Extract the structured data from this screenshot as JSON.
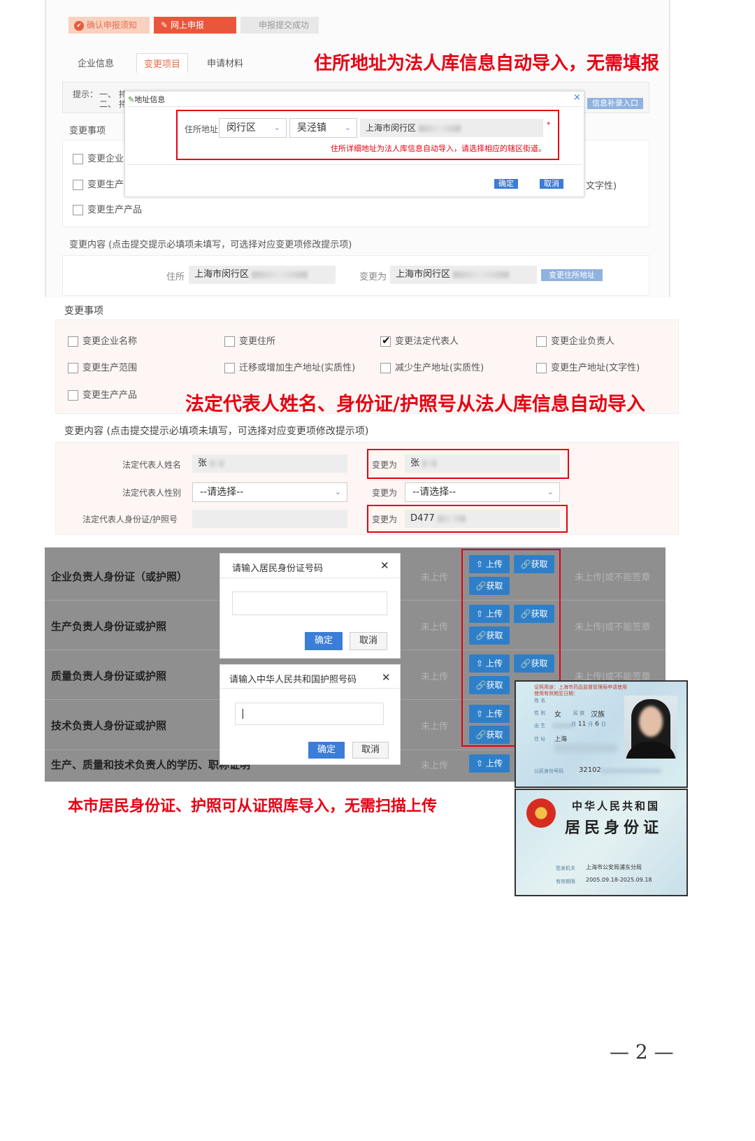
{
  "steps": [
    "确认申报须知",
    "网上申报",
    "申报提交成功"
  ],
  "tabs": [
    "企业信息",
    "变更项目",
    "申请材料"
  ],
  "top_note": "住所地址为法人库信息自动导入，无需填报",
  "hint_label": "提示：",
  "hint_lines": [
    "一、 持",
    "二、 持"
  ],
  "supplement_link": "信息补录入口",
  "address_dialog": {
    "title": "地址信息",
    "close": "×",
    "field_label": "住所地址",
    "district": "闵行区",
    "town": "吴泾镇",
    "detail_prefix": "上海市闵行区",
    "required_mark": "*",
    "tip": "住所详细地址为法人库信息自动导入，请选择相应的辖区街道。",
    "confirm": "确定",
    "cancel": "取消"
  },
  "upper_section": {
    "items_title": "变更事项",
    "items": [
      "变更企业",
      "变更生产",
      "变更生产产品"
    ],
    "right_fragment": "文字性)",
    "content_title": "变更内容 (点击提交提示必填项未填写，可选择对应变更项修改提示项)",
    "address_label": "住所",
    "address_value": "上海市闵行区",
    "change_to": "变更为",
    "change_value": "上海市闵行区",
    "change_btn": "变更住所地址"
  },
  "items_section": {
    "title": "变更事项",
    "rows": [
      [
        {
          "label": "变更企业名称",
          "checked": false
        },
        {
          "label": "变更住所",
          "checked": false
        },
        {
          "label": "变更法定代表人",
          "checked": true
        },
        {
          "label": "变更企业负责人",
          "checked": false
        }
      ],
      [
        {
          "label": "变更生产范围",
          "checked": false
        },
        {
          "label": "迁移或增加生产地址(实质性)",
          "checked": false
        },
        {
          "label": "减少生产地址(实质性)",
          "checked": false
        },
        {
          "label": "变更生产地址(文字性)",
          "checked": false
        }
      ],
      [
        {
          "label": "变更生产产品",
          "checked": false
        }
      ]
    ]
  },
  "legal_note": "法定代表人姓名、身份证/护照号从法人库信息自动导入",
  "content_section": {
    "title": "变更内容 (点击提交提示必填项未填写，可选择对应变更项修改提示项)",
    "name_label": "法定代表人姓名",
    "name_value": "张",
    "gender_label": "法定代表人性别",
    "gender_value": "--请选择--",
    "id_label": "法定代表人身份证/护照号",
    "change_to": "变更为",
    "name_new": "张",
    "gender_new": "--请选择--",
    "id_new": "D477"
  },
  "upload_section": {
    "rows": [
      {
        "label": "企业负责人身份证（或护照）",
        "status": "未上传",
        "right": "未上传|或不能签章"
      },
      {
        "label": "生产负责人身份证或护照",
        "status": "未上传",
        "right": "未上传|或不能签章"
      },
      {
        "label": "质量负责人身份证或护照",
        "status": "未上传",
        "right": "未上传|或不能签章"
      },
      {
        "label": "技术负责人身份证或护照",
        "status": "未上传",
        "right": ""
      },
      {
        "label": "生产、质量和技术负责人的学历、职称证明",
        "status": "未上传",
        "right": ""
      }
    ],
    "upload_btn": "上传",
    "fetch_btn": "获取"
  },
  "id_dialog": {
    "title": "请输入居民身份证号码",
    "close": "✕",
    "confirm": "确定",
    "cancel": "取消"
  },
  "passport_dialog": {
    "title": "请输入中华人民共和国护照号码",
    "close": "✕",
    "cursor": "|",
    "confirm": "确定",
    "cancel": "取消"
  },
  "id_card": {
    "purpose": "证照用途：上海市药品监督管理局申请使用",
    "validity": "使用有效期至日期：",
    "name_label": "姓 名",
    "gender_label": "性 别",
    "gender": "女",
    "ethnicity_label": "民 族",
    "ethnicity": "汉族",
    "birth_label": "出 生",
    "birth_month": "11",
    "month_char": "月",
    "birth_day": "6",
    "day_char": "日",
    "address_label": "住 址",
    "address": "上海",
    "id_label": "公民身份号码",
    "id_no": "32102",
    "back_title1": "中华人民共和国",
    "back_title2": "居民身份证",
    "authority_label": "签发机关",
    "authority": "上海市公安局浦东分局",
    "expiry_label": "有效期限",
    "expiry": "2005.09.18-2025.09.18"
  },
  "bottom_note": "本市居民身份证、护照可从证照库导入，无需扫描上传",
  "page_number": "— 2 —",
  "colors": {
    "red": "#e60012",
    "blue": "#3b7dd8",
    "gray": "#8f8f8f"
  }
}
